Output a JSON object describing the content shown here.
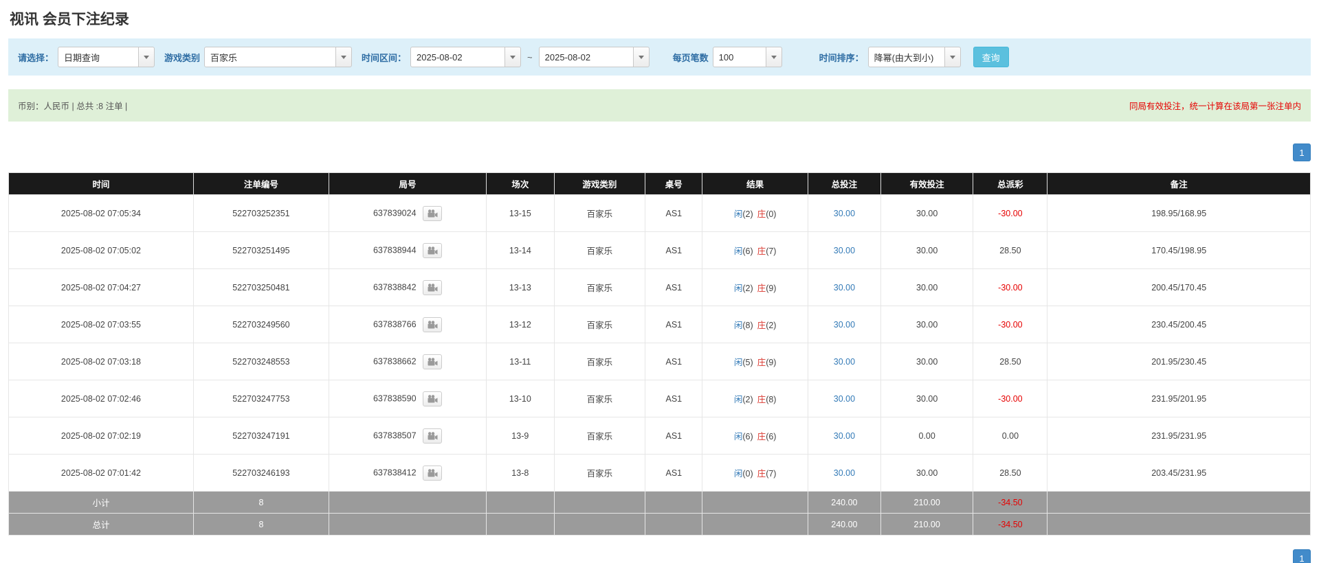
{
  "colors": {
    "accent_blue": "#337ab7",
    "filter_bar_bg": "#ddf0f9",
    "info_bar_bg": "#dff0d8",
    "table_header_bg": "#1a1a1a",
    "summary_row_bg": "#9b9b9b",
    "player_blue": "#337ab7",
    "banker_red": "#d9342b",
    "negative_red": "#e60000",
    "search_button_bg": "#5bc0de",
    "pagination_bg": "#428bca"
  },
  "icons": {
    "dropdown_arrow": "▼",
    "video_replay": "video-camera"
  },
  "page": {
    "title": "视讯 会员下注纪录"
  },
  "filters": {
    "select_label": "请选择：",
    "select_value": "日期查询",
    "game_label": "游戏类别",
    "game_value": "百家乐",
    "range_label": "时间区间：",
    "date_from": "2025-08-02",
    "range_separator": "~",
    "date_to": "2025-08-02",
    "per_page_label": "每页笔数",
    "per_page_value": "100",
    "sort_label": "时间排序：",
    "sort_value": "降幂(由大到小)",
    "search_button": "查询"
  },
  "info_bar": {
    "left": "币别：人民币 | 总共 :8 注单 |",
    "right": "同局有效投注，统一计算在该局第一张注单内"
  },
  "pagination": {
    "page": "1"
  },
  "table": {
    "headers": [
      "时间",
      "注单编号",
      "局号",
      "场次",
      "游戏类别",
      "桌号",
      "结果",
      "总投注",
      "有效投注",
      "总派彩",
      "备注"
    ],
    "rows": [
      {
        "time": "2025-08-02 07:05:34",
        "bet_id": "522703252351",
        "round_id": "637839024",
        "session": "13-15",
        "game": "百家乐",
        "table_no": "AS1",
        "player": "闲",
        "player_n": "(2)",
        "banker": "庄",
        "banker_n": "(0)",
        "total_bet": "30.00",
        "valid_bet": "30.00",
        "payout": "-30.00",
        "note": "198.95/168.95"
      },
      {
        "time": "2025-08-02 07:05:02",
        "bet_id": "522703251495",
        "round_id": "637838944",
        "session": "13-14",
        "game": "百家乐",
        "table_no": "AS1",
        "player": "闲",
        "player_n": "(6)",
        "banker": "庄",
        "banker_n": "(7)",
        "total_bet": "30.00",
        "valid_bet": "30.00",
        "payout": "28.50",
        "note": "170.45/198.95"
      },
      {
        "time": "2025-08-02 07:04:27",
        "bet_id": "522703250481",
        "round_id": "637838842",
        "session": "13-13",
        "game": "百家乐",
        "table_no": "AS1",
        "player": "闲",
        "player_n": "(2)",
        "banker": "庄",
        "banker_n": "(9)",
        "total_bet": "30.00",
        "valid_bet": "30.00",
        "payout": "-30.00",
        "note": "200.45/170.45"
      },
      {
        "time": "2025-08-02 07:03:55",
        "bet_id": "522703249560",
        "round_id": "637838766",
        "session": "13-12",
        "game": "百家乐",
        "table_no": "AS1",
        "player": "闲",
        "player_n": "(8)",
        "banker": "庄",
        "banker_n": "(2)",
        "total_bet": "30.00",
        "valid_bet": "30.00",
        "payout": "-30.00",
        "note": "230.45/200.45"
      },
      {
        "time": "2025-08-02 07:03:18",
        "bet_id": "522703248553",
        "round_id": "637838662",
        "session": "13-11",
        "game": "百家乐",
        "table_no": "AS1",
        "player": "闲",
        "player_n": "(5)",
        "banker": "庄",
        "banker_n": "(9)",
        "total_bet": "30.00",
        "valid_bet": "30.00",
        "payout": "28.50",
        "note": "201.95/230.45"
      },
      {
        "time": "2025-08-02 07:02:46",
        "bet_id": "522703247753",
        "round_id": "637838590",
        "session": "13-10",
        "game": "百家乐",
        "table_no": "AS1",
        "player": "闲",
        "player_n": "(2)",
        "banker": "庄",
        "banker_n": "(8)",
        "total_bet": "30.00",
        "valid_bet": "30.00",
        "payout": "-30.00",
        "note": "231.95/201.95"
      },
      {
        "time": "2025-08-02 07:02:19",
        "bet_id": "522703247191",
        "round_id": "637838507",
        "session": "13-9",
        "game": "百家乐",
        "table_no": "AS1",
        "player": "闲",
        "player_n": "(6)",
        "banker": "庄",
        "banker_n": "(6)",
        "total_bet": "30.00",
        "valid_bet": "0.00",
        "payout": "0.00",
        "note": "231.95/231.95"
      },
      {
        "time": "2025-08-02 07:01:42",
        "bet_id": "522703246193",
        "round_id": "637838412",
        "session": "13-8",
        "game": "百家乐",
        "table_no": "AS1",
        "player": "闲",
        "player_n": "(0)",
        "banker": "庄",
        "banker_n": "(7)",
        "total_bet": "30.00",
        "valid_bet": "30.00",
        "payout": "28.50",
        "note": "203.45/231.95"
      }
    ],
    "subtotal": {
      "label": "小计",
      "count": "8",
      "total_bet": "240.00",
      "valid_bet": "210.00",
      "payout": "-34.50"
    },
    "total": {
      "label": "总计",
      "count": "8",
      "total_bet": "240.00",
      "valid_bet": "210.00",
      "payout": "-34.50"
    }
  }
}
